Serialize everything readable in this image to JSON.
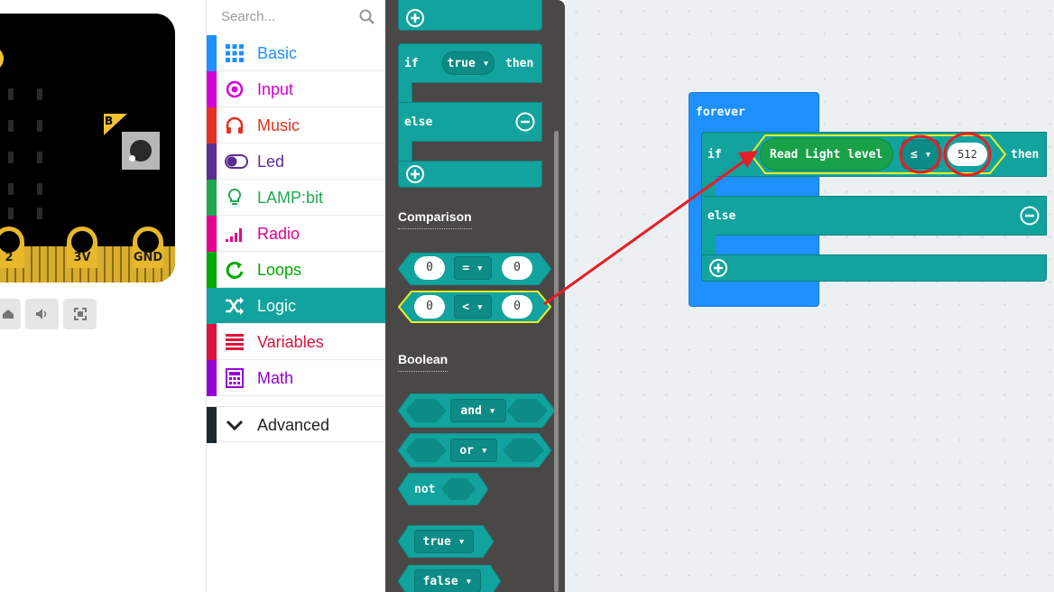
{
  "simulator": {
    "pins": [
      "2",
      "3V",
      "GND"
    ],
    "button_b_label": "B",
    "controls": [
      "stop-icon",
      "sound-icon",
      "fullscreen-icon"
    ]
  },
  "toolbox": {
    "search_placeholder": "Search...",
    "categories": [
      {
        "label": "Basic",
        "color": "#1e90ff",
        "icon": "grid-icon"
      },
      {
        "label": "Input",
        "color": "#d400d4",
        "icon": "target-icon"
      },
      {
        "label": "Music",
        "color": "#e63022",
        "icon": "headphones-icon"
      },
      {
        "label": "Led",
        "color": "#5c2d91",
        "icon": "toggle-icon"
      },
      {
        "label": "LAMP:bit",
        "color": "#1fa84f",
        "icon": "lightbulb-icon"
      },
      {
        "label": "Radio",
        "color": "#e3008c",
        "icon": "signal-icon"
      },
      {
        "label": "Loops",
        "color": "#00aa00",
        "icon": "loop-icon"
      },
      {
        "label": "Logic",
        "color": "#12a39e",
        "icon": "shuffle-icon"
      },
      {
        "label": "Variables",
        "color": "#dc143c",
        "icon": "list-icon"
      },
      {
        "label": "Math",
        "color": "#9400d3",
        "icon": "calculator-icon"
      }
    ],
    "advanced_label": "Advanced"
  },
  "flyout": {
    "if_keyword": "if",
    "true_value": "true",
    "then_keyword": "then",
    "else_keyword": "else",
    "comparison_heading": "Comparison",
    "compare_eq": {
      "left": "0",
      "op": "=",
      "right": "0"
    },
    "compare_lt": {
      "left": "0",
      "op": "<",
      "right": "0"
    },
    "boolean_heading": "Boolean",
    "and_label": "and",
    "or_label": "or",
    "not_label": "not",
    "true_label": "true",
    "false_label": "false"
  },
  "workspace": {
    "forever_label": "forever",
    "if_keyword": "if",
    "sensor_label": "Read Light level",
    "operator": "≤",
    "compare_value": "512",
    "then_keyword": "then",
    "else_keyword": "else"
  },
  "colors": {
    "logic": "#12a39e",
    "loops": "#1e90ff",
    "sensor": "#19a14a",
    "highlight": "#f0f01e",
    "annotation": "#e41e26"
  }
}
